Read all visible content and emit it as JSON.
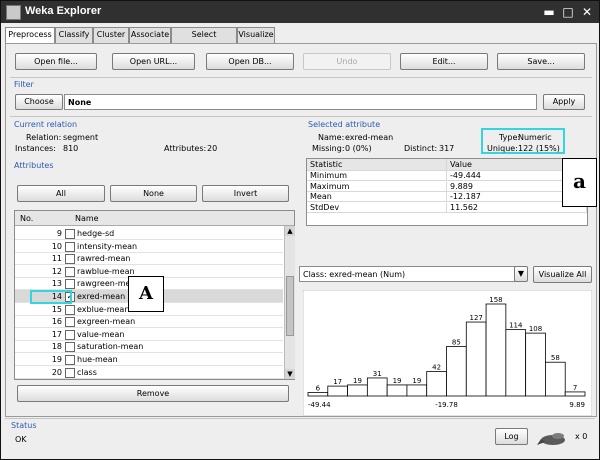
{
  "window": {
    "title": "Weka Explorer"
  },
  "tabs": [
    "Preprocess",
    "Classify",
    "Cluster",
    "Associate",
    "Select attributes",
    "Visualize"
  ],
  "toolbar": {
    "open_file": "Open file...",
    "open_url": "Open URL...",
    "open_db": "Open DB...",
    "undo": "Undo",
    "edit": "Edit...",
    "save": "Save..."
  },
  "filter": {
    "title": "Filter",
    "choose": "Choose",
    "value": "None",
    "apply": "Apply"
  },
  "current_relation": {
    "title": "Current relation",
    "relation_label": "Relation:",
    "relation_value": "segment",
    "instances_label": "Instances:",
    "instances_value": "810",
    "attributes_label": "Attributes:",
    "attributes_value": "20"
  },
  "attributes": {
    "title": "Attributes",
    "all": "All",
    "none": "None",
    "invert": "Invert",
    "col_no": "No.",
    "col_name": "Name",
    "rows": [
      {
        "no": "9",
        "name": "hedge-sd",
        "checked": false
      },
      {
        "no": "10",
        "name": "intensity-mean",
        "checked": false
      },
      {
        "no": "11",
        "name": "rawred-mean",
        "checked": false
      },
      {
        "no": "12",
        "name": "rawblue-mean",
        "checked": false
      },
      {
        "no": "13",
        "name": "rawgreen-me",
        "checked": false
      },
      {
        "no": "14",
        "name": "exred-mean",
        "checked": true
      },
      {
        "no": "15",
        "name": "exblue-mean",
        "checked": false
      },
      {
        "no": "16",
        "name": "exgreen-mean",
        "checked": false
      },
      {
        "no": "17",
        "name": "value-mean",
        "checked": false
      },
      {
        "no": "18",
        "name": "saturation-mean",
        "checked": false
      },
      {
        "no": "19",
        "name": "hue-mean",
        "checked": false
      },
      {
        "no": "20",
        "name": "class",
        "checked": false
      }
    ],
    "remove": "Remove"
  },
  "selected_attribute": {
    "title": "Selected attribute",
    "name_label": "Name:",
    "name_value": "exred-mean",
    "type_label": "Type:",
    "type_value": "Numeric",
    "missing_label": "Missing:",
    "missing_value": "0 (0%)",
    "distinct_label": "Distinct:",
    "distinct_value": "317",
    "unique_label": "Unique:",
    "unique_value": "122 (15%)",
    "col_statistic": "Statistic",
    "col_value": "Value",
    "stats": [
      {
        "name": "Minimum",
        "value": "-49.444"
      },
      {
        "name": "Maximum",
        "value": "9.889"
      },
      {
        "name": "Mean",
        "value": "-12.187"
      },
      {
        "name": "StdDev",
        "value": "11.562"
      }
    ]
  },
  "class_select": {
    "value": "Class: exred-mean (Num)",
    "visualize_all": "Visualize All"
  },
  "chart_data": {
    "type": "bar",
    "values": [
      6,
      17,
      19,
      31,
      19,
      19,
      42,
      85,
      127,
      158,
      114,
      108,
      58,
      7
    ],
    "x_ticks": [
      "-49.44",
      "-19.78",
      "9.89"
    ],
    "xlim": [
      -49.44,
      9.89
    ],
    "ylim": [
      0,
      158
    ],
    "title": "",
    "xlabel": "",
    "ylabel": ""
  },
  "status": {
    "title": "Status",
    "text": "OK",
    "log": "Log",
    "count": "x 0"
  },
  "annotations": {
    "a": "a",
    "A": "A"
  },
  "colors": {
    "highlight": "#33d6e0",
    "titlebar": "#303030",
    "section": "#2a5db0"
  }
}
